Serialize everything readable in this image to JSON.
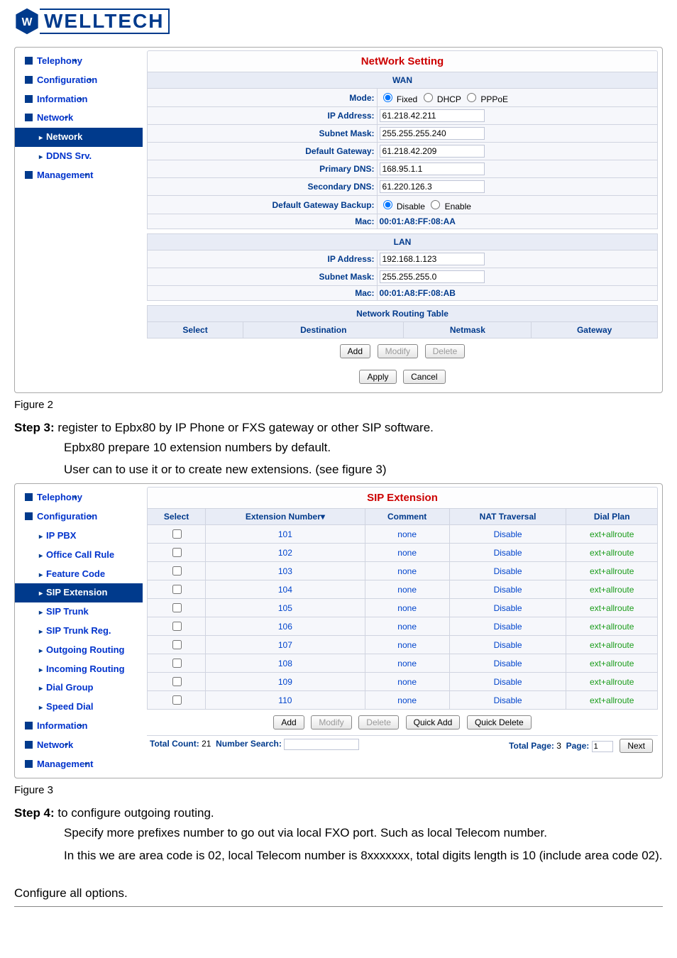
{
  "logo": {
    "text": "WELLTECH"
  },
  "fig2_sidebar": [
    {
      "label": "Telephony",
      "lvl": 1,
      "sym": "plus"
    },
    {
      "label": "Configuration",
      "lvl": 1,
      "sym": "plus"
    },
    {
      "label": "Information",
      "lvl": 1,
      "sym": "plus"
    },
    {
      "label": "Network",
      "lvl": 1,
      "sym": "minus"
    },
    {
      "label": "Network",
      "lvl": 2,
      "active": true
    },
    {
      "label": "DDNS Srv.",
      "lvl": 2
    },
    {
      "label": "Management",
      "lvl": 1,
      "sym": "plus"
    }
  ],
  "fig2": {
    "title": "NetWork Setting",
    "wan_header": "WAN",
    "mode_label": "Mode:",
    "mode_options": [
      "Fixed",
      "DHCP",
      "PPPoE"
    ],
    "mode_selected": "Fixed",
    "wan_rows": [
      {
        "label": "IP Address:",
        "value": "61.218.42.211"
      },
      {
        "label": "Subnet Mask:",
        "value": "255.255.255.240"
      },
      {
        "label": "Default Gateway:",
        "value": "61.218.42.209"
      },
      {
        "label": "Primary DNS:",
        "value": "168.95.1.1"
      },
      {
        "label": "Secondary DNS:",
        "value": "61.220.126.3"
      }
    ],
    "gwbackup_label": "Default Gateway Backup:",
    "gwbackup_options": [
      "Disable",
      "Enable"
    ],
    "gwbackup_selected": "Disable",
    "mac_label": "Mac:",
    "wan_mac": "00:01:A8:FF:08:AA",
    "lan_header": "LAN",
    "lan_rows": [
      {
        "label": "IP Address:",
        "value": "192.168.1.123"
      },
      {
        "label": "Subnet Mask:",
        "value": "255.255.255.0"
      }
    ],
    "lan_mac": "00:01:A8:FF:08:AB",
    "route_header": "Network Routing Table",
    "route_cols": [
      "Select",
      "Destination",
      "Netmask",
      "Gateway"
    ],
    "buttons": {
      "add": "Add",
      "modify": "Modify",
      "delete": "Delete",
      "apply": "Apply",
      "cancel": "Cancel"
    }
  },
  "fig2_caption": "Figure 2",
  "step3": {
    "heading": "Step 3:",
    "line1": " register to Epbx80 by IP Phone or FXS gateway or other SIP software.",
    "line2": "Epbx80 prepare 10 extension numbers by default.",
    "line3": "User can to use it or to create new extensions. (see figure 3)"
  },
  "fig3_sidebar": [
    {
      "label": "Telephony",
      "lvl": 1,
      "sym": "plus"
    },
    {
      "label": "Configuration",
      "lvl": 1,
      "sym": "minus"
    },
    {
      "label": "IP PBX",
      "lvl": 2
    },
    {
      "label": "Office Call Rule",
      "lvl": 2
    },
    {
      "label": "Feature Code",
      "lvl": 2
    },
    {
      "label": "SIP Extension",
      "lvl": 2,
      "active": true
    },
    {
      "label": "SIP Trunk",
      "lvl": 2
    },
    {
      "label": "SIP Trunk Reg.",
      "lvl": 2
    },
    {
      "label": "Outgoing Routing",
      "lvl": 2
    },
    {
      "label": "Incoming Routing",
      "lvl": 2
    },
    {
      "label": "Dial Group",
      "lvl": 2
    },
    {
      "label": "Speed Dial",
      "lvl": 2
    },
    {
      "label": "Information",
      "lvl": 1,
      "sym": "plus"
    },
    {
      "label": "Network",
      "lvl": 1,
      "sym": "plus"
    },
    {
      "label": "Management",
      "lvl": 1,
      "sym": "plus"
    }
  ],
  "fig3": {
    "title": "SIP Extension",
    "cols": [
      "Select",
      "Extension Number▾",
      "Comment",
      "NAT Traversal",
      "Dial Plan"
    ],
    "rows": [
      {
        "ext": "101",
        "comment": "none",
        "nat": "Disable",
        "plan": "ext+allroute"
      },
      {
        "ext": "102",
        "comment": "none",
        "nat": "Disable",
        "plan": "ext+allroute"
      },
      {
        "ext": "103",
        "comment": "none",
        "nat": "Disable",
        "plan": "ext+allroute"
      },
      {
        "ext": "104",
        "comment": "none",
        "nat": "Disable",
        "plan": "ext+allroute"
      },
      {
        "ext": "105",
        "comment": "none",
        "nat": "Disable",
        "plan": "ext+allroute"
      },
      {
        "ext": "106",
        "comment": "none",
        "nat": "Disable",
        "plan": "ext+allroute"
      },
      {
        "ext": "107",
        "comment": "none",
        "nat": "Disable",
        "plan": "ext+allroute"
      },
      {
        "ext": "108",
        "comment": "none",
        "nat": "Disable",
        "plan": "ext+allroute"
      },
      {
        "ext": "109",
        "comment": "none",
        "nat": "Disable",
        "plan": "ext+allroute"
      },
      {
        "ext": "110",
        "comment": "none",
        "nat": "Disable",
        "plan": "ext+allroute"
      }
    ],
    "buttons": {
      "add": "Add",
      "modify": "Modify",
      "delete": "Delete",
      "quickadd": "Quick Add",
      "quickdel": "Quick Delete",
      "next": "Next"
    },
    "pager": {
      "total_label": "Total Count:",
      "total": "21",
      "search_label": "Number Search:",
      "page_label": "Total Page:",
      "total_pages": "3",
      "page_label2": "Page:",
      "page": "1"
    }
  },
  "fig3_caption": "Figure 3",
  "step4": {
    "heading": "Step 4:",
    "line1": " to configure outgoing routing.",
    "line2": "Specify more prefixes number to go out via local FXO port. Such as local Telecom number.",
    "line3": "In this we are area code is 02, local Telecom number is 8xxxxxxx, total digits length is 10 (include area code 02)."
  },
  "final": "Configure all options."
}
